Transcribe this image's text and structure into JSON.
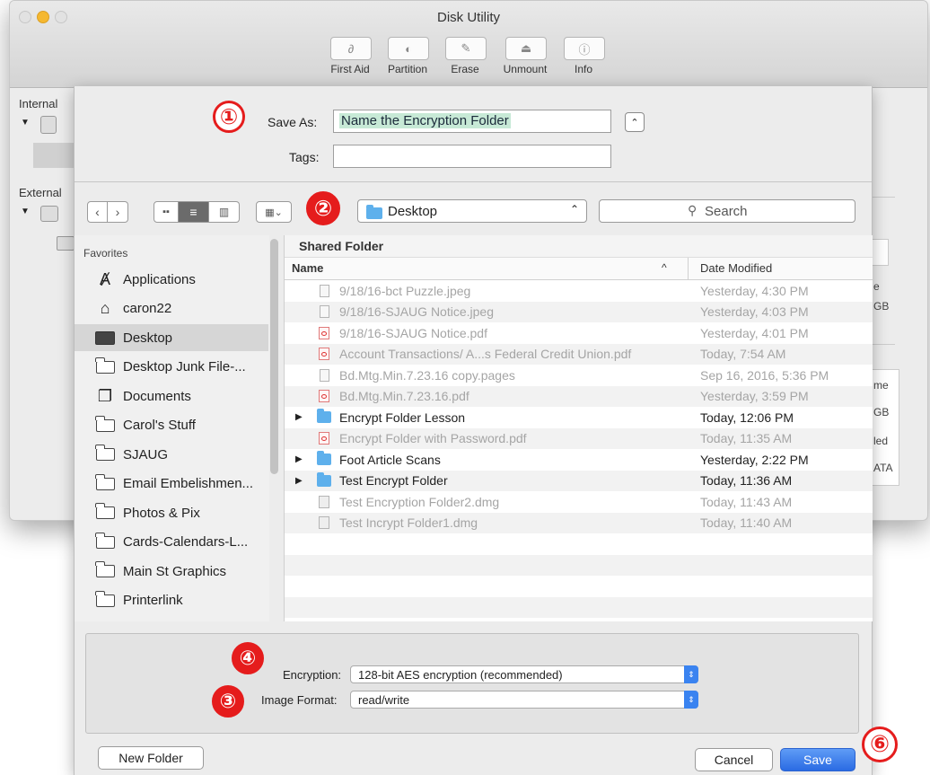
{
  "app": {
    "title": "Disk Utility",
    "toolbar": [
      {
        "label": "First Aid",
        "icon": "stethoscope-icon"
      },
      {
        "label": "Partition",
        "icon": "pie-icon"
      },
      {
        "label": "Erase",
        "icon": "eraser-icon"
      },
      {
        "label": "Unmount",
        "icon": "eject-icon"
      },
      {
        "label": "Info",
        "icon": "info-icon"
      }
    ],
    "sidebar_sections": [
      "Internal",
      "External"
    ],
    "right_fragments": [
      "e",
      "GB",
      "me",
      "GB",
      "led",
      "ATA"
    ]
  },
  "sheet": {
    "save_as_label": "Save As:",
    "save_as_value": "Name the Encryption Folder",
    "tags_label": "Tags:",
    "tags_value": "",
    "location": "Desktop",
    "search_placeholder": "Search",
    "favorites_header": "Favorites",
    "favorites": [
      {
        "label": "Applications",
        "icon": "applications-icon",
        "selected": false
      },
      {
        "label": "caron22",
        "icon": "home-icon",
        "selected": false
      },
      {
        "label": "Desktop",
        "icon": "desktop-icon",
        "selected": true
      },
      {
        "label": "Desktop Junk File-...",
        "icon": "folder-icon",
        "selected": false
      },
      {
        "label": "Documents",
        "icon": "documents-icon",
        "selected": false
      },
      {
        "label": "Carol's Stuff",
        "icon": "folder-icon",
        "selected": false
      },
      {
        "label": "SJAUG",
        "icon": "folder-icon",
        "selected": false
      },
      {
        "label": "Email Embelishmen...",
        "icon": "folder-icon",
        "selected": false
      },
      {
        "label": "Photos & Pix",
        "icon": "folder-icon",
        "selected": false
      },
      {
        "label": "Cards-Calendars-L...",
        "icon": "folder-icon",
        "selected": false
      },
      {
        "label": "Main St Graphics",
        "icon": "folder-icon",
        "selected": false
      },
      {
        "label": "Printerlink",
        "icon": "folder-icon",
        "selected": false
      }
    ],
    "list_title": "Shared Folder",
    "col_name": "Name",
    "col_date": "Date Modified",
    "sort_indicator": "^",
    "files": [
      {
        "name": "9/18/16-bct Puzzle.jpeg",
        "date": "Yesterday, 4:30 PM",
        "kind": "doc",
        "dim": true,
        "folder": false
      },
      {
        "name": "9/18/16-SJAUG Notice.jpeg",
        "date": "Yesterday, 4:03 PM",
        "kind": "doc",
        "dim": true,
        "folder": false
      },
      {
        "name": "9/18/16-SJAUG Notice.pdf",
        "date": "Yesterday, 4:01 PM",
        "kind": "pdf",
        "dim": true,
        "folder": false
      },
      {
        "name": "Account Transactions/ A...s Federal Credit Union.pdf",
        "date": "Today, 7:54 AM",
        "kind": "pdf",
        "dim": true,
        "folder": false
      },
      {
        "name": "Bd.Mtg.Min.7.23.16 copy.pages",
        "date": "Sep 16, 2016, 5:36 PM",
        "kind": "doc",
        "dim": true,
        "folder": false
      },
      {
        "name": "Bd.Mtg.Min.7.23.16.pdf",
        "date": "Yesterday, 3:59 PM",
        "kind": "pdf",
        "dim": true,
        "folder": false
      },
      {
        "name": "Encrypt Folder Lesson",
        "date": "Today, 12:06 PM",
        "kind": "folder",
        "dim": false,
        "folder": true
      },
      {
        "name": "Encrypt Folder with Password.pdf",
        "date": "Today, 11:35 AM",
        "kind": "pdf",
        "dim": true,
        "folder": false
      },
      {
        "name": "Foot Article Scans",
        "date": "Yesterday, 2:22 PM",
        "kind": "folder",
        "dim": false,
        "folder": true
      },
      {
        "name": "Test Encrypt Folder",
        "date": "Today, 11:36 AM",
        "kind": "folder",
        "dim": false,
        "folder": true
      },
      {
        "name": "Test Encryption Folder2.dmg",
        "date": "Today, 11:43 AM",
        "kind": "dmg",
        "dim": true,
        "folder": false
      },
      {
        "name": "Test Incrypt Folder1.dmg",
        "date": "Today, 11:40 AM",
        "kind": "dmg",
        "dim": true,
        "folder": false
      }
    ],
    "encryption_label": "Encryption:",
    "encryption_value": "128-bit AES encryption (recommended)",
    "image_format_label": "Image Format:",
    "image_format_value": "read/write",
    "new_folder_label": "New Folder",
    "cancel_label": "Cancel",
    "save_label": "Save"
  },
  "markers": [
    "①",
    "②",
    "③",
    "④",
    "⑥"
  ],
  "colors": {
    "accent": "#2a6be3",
    "marker": "#e51c1c",
    "folder": "#5eb0ec",
    "selection_text_bg": "#c7e9d6"
  }
}
